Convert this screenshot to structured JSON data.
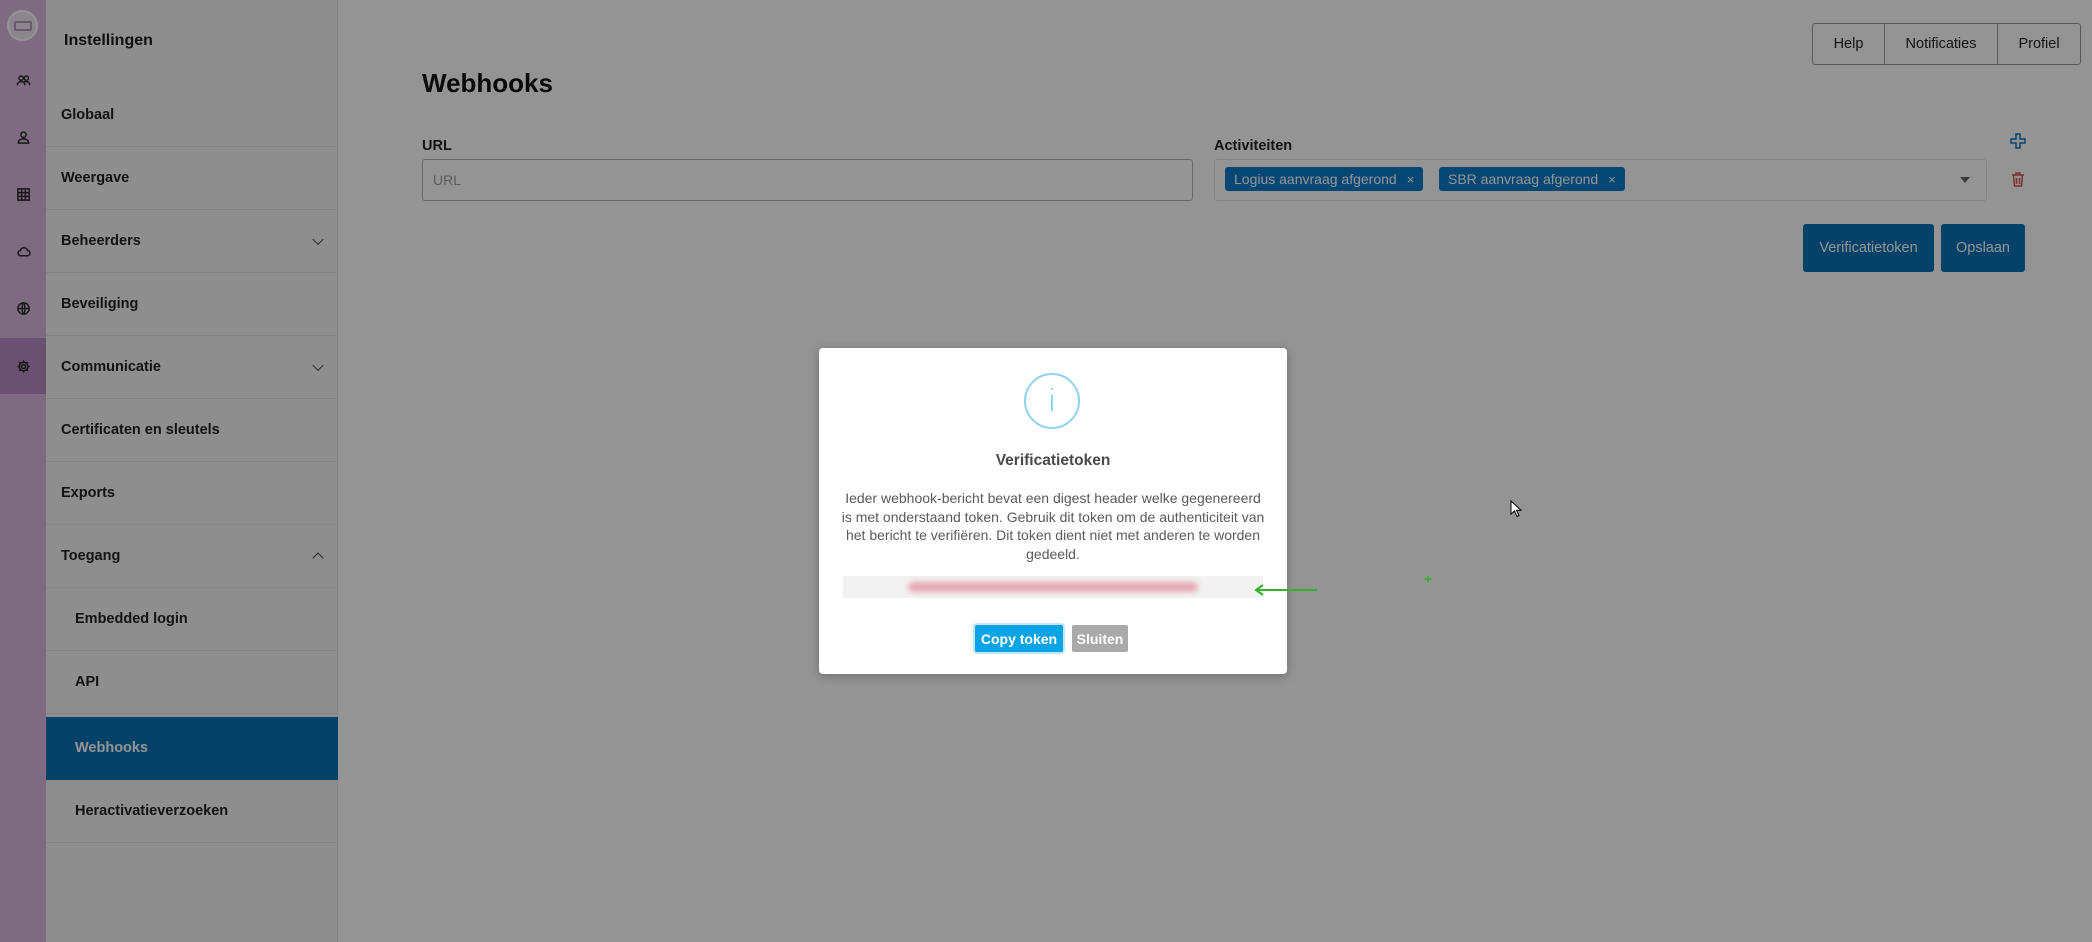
{
  "rail": {
    "icons": [
      "users-icon",
      "user-icon",
      "grid-icon",
      "cloud-icon",
      "globe-icon",
      "gear-icon"
    ],
    "active": "gear-icon"
  },
  "sidebar": {
    "title": "Instellingen",
    "items": [
      {
        "label": "Globaal"
      },
      {
        "label": "Weergave"
      },
      {
        "label": "Beheerders"
      },
      {
        "label": "Beveiliging"
      },
      {
        "label": "Communicatie"
      },
      {
        "label": "Certificaten en sleutels"
      },
      {
        "label": "Exports"
      },
      {
        "label": "Toegang"
      },
      {
        "label": "Embedded login"
      },
      {
        "label": "API"
      },
      {
        "label": "Webhooks"
      },
      {
        "label": "Heractivatieverzoeken"
      }
    ]
  },
  "topbar": {
    "help": "Help",
    "notifications": "Notificaties",
    "profile": "Profiel"
  },
  "page": {
    "title": "Webhooks",
    "url_label": "URL",
    "url_placeholder": "URL",
    "url_value": "",
    "activities_label": "Activiteiten",
    "activities": [
      {
        "label": "Logius aanvraag afgerond",
        "remove": "×"
      },
      {
        "label": "SBR aanvraag afgerond",
        "remove": "×"
      }
    ],
    "verification_button": "Verificatietoken",
    "save_button": "Opslaan"
  },
  "modal": {
    "icon": "info-icon",
    "icon_glyph": "i",
    "title": "Verificatietoken",
    "text": "Ieder webhook-bericht bevat een digest header welke gegenereerd is met onderstaand token. Gebruik dit token om de authenticiteit van het bericht te verifiëren. Dit token dient niet met anderen te worden gedeeld.",
    "copy_button": "Copy token",
    "close_button": "Sluiten"
  },
  "colors": {
    "rail": "#d9b8df",
    "rail_active": "#b98cc3",
    "primary": "#0a72b5",
    "tag": "#0a7bc8",
    "copy": "#0aa4e6",
    "close": "#a9a9a9",
    "annotation": "#35b02a"
  }
}
